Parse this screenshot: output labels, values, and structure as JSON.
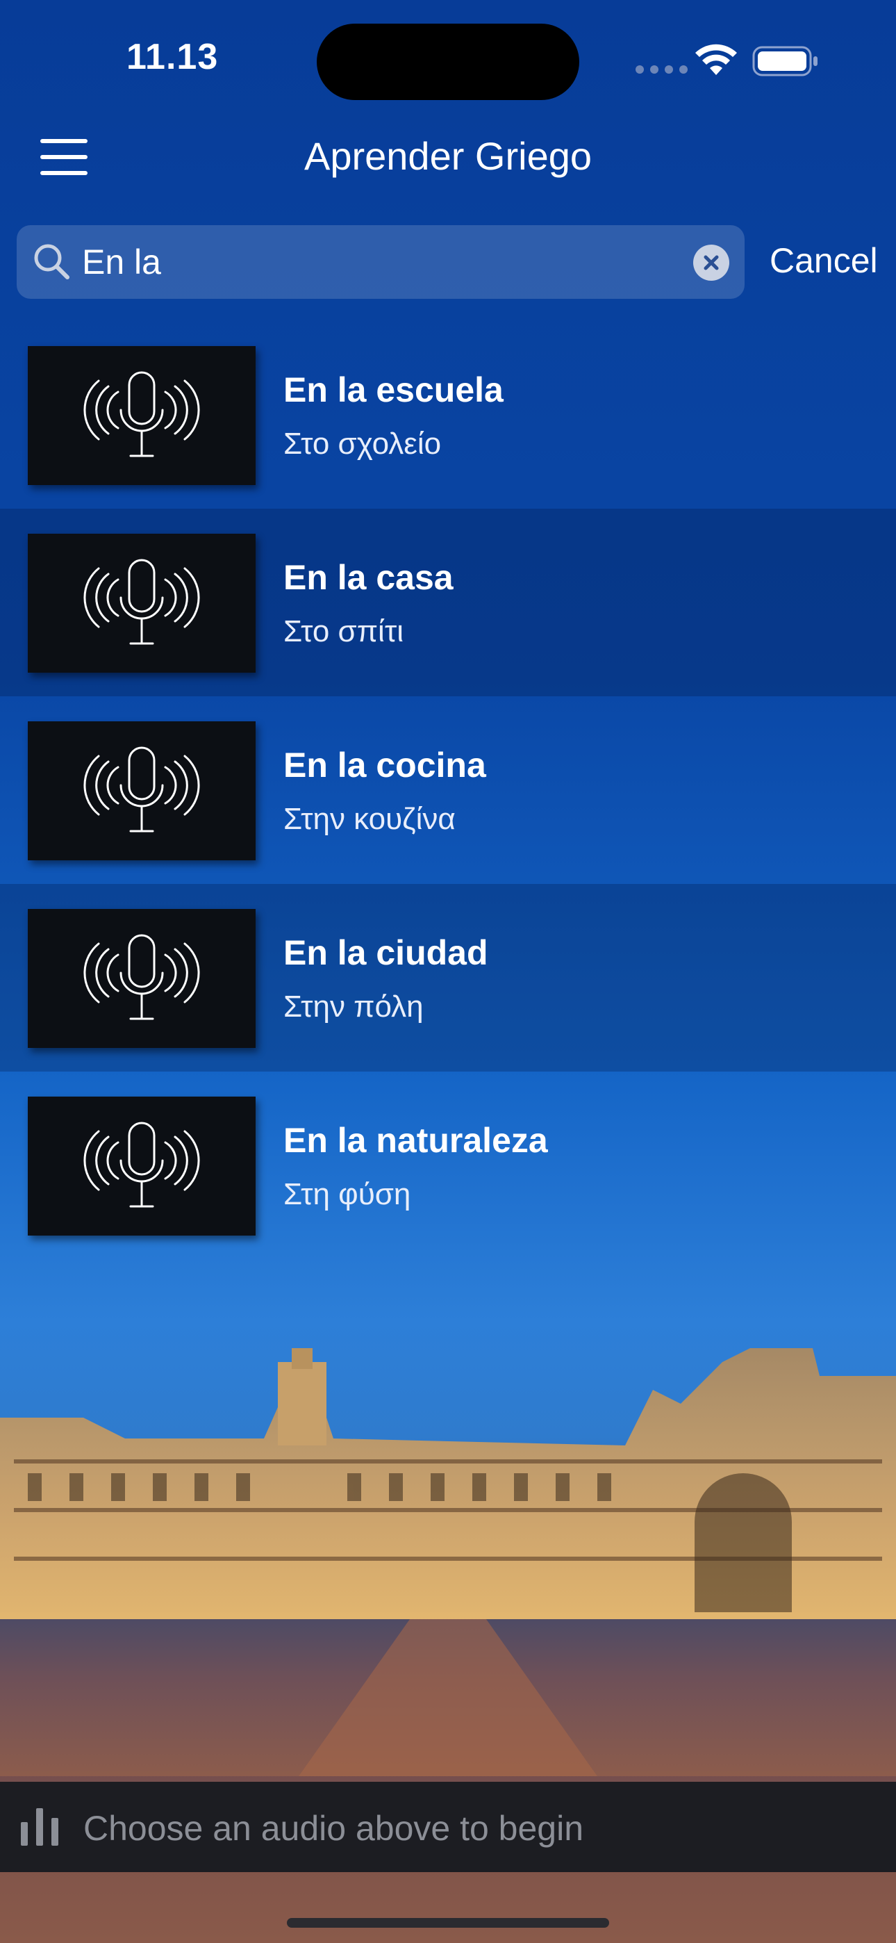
{
  "status_bar": {
    "time": "11.13"
  },
  "nav": {
    "title": "Aprender Griego"
  },
  "search": {
    "value": "En la",
    "cancel_label": "Cancel"
  },
  "items": [
    {
      "title": "En la escuela",
      "subtitle": "Στο σχολείο"
    },
    {
      "title": "En la casa",
      "subtitle": "Στο σπίτι"
    },
    {
      "title": "En la cocina",
      "subtitle": "Στην κουζίνα"
    },
    {
      "title": "En la ciudad",
      "subtitle": "Στην πόλη"
    },
    {
      "title": "En la naturaleza",
      "subtitle": "Στη φύση"
    }
  ],
  "player": {
    "text": "Choose an audio above to begin"
  },
  "colors": {
    "background": "#0a47a6",
    "player_bar": "#1c1d22",
    "thumb": "#0c0f14"
  }
}
